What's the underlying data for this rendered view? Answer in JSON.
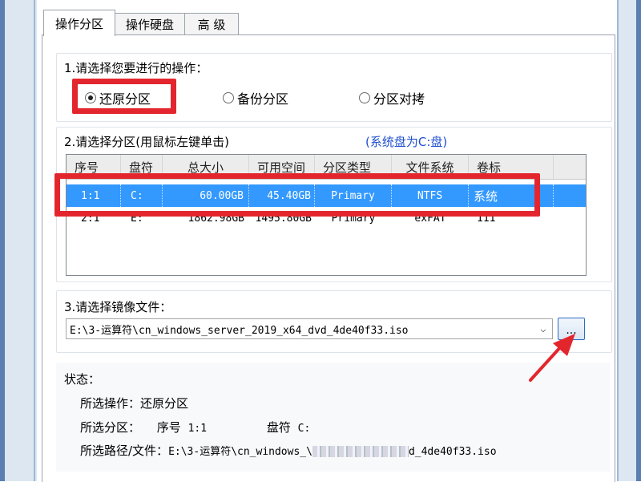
{
  "tabs": [
    {
      "label": "操作分区"
    },
    {
      "label": "操作硬盘"
    },
    {
      "label": "高 级"
    }
  ],
  "section1": {
    "label": "1.请选择您要进行的操作：",
    "options": [
      {
        "label": "还原分区",
        "selected": true
      },
      {
        "label": "备份分区",
        "selected": false
      },
      {
        "label": "分区对拷",
        "selected": false
      }
    ]
  },
  "section2": {
    "label": "2.请选择分区(用鼠标左键单击)",
    "hint": "(系统盘为C:盘)",
    "columns": [
      "序号",
      "盘符",
      "总大小",
      "可用空间",
      "分区类型",
      "文件系统",
      "卷标"
    ],
    "rows": [
      {
        "index": "1:1",
        "drive": "C:",
        "total": "60.00GB",
        "free": "45.40GB",
        "type": "Primary",
        "fs": "NTFS",
        "label": "系统",
        "selected": true
      },
      {
        "index": "2:1",
        "drive": "E:",
        "total": "1862.98GB",
        "free": "1495.80GB",
        "type": "Primary",
        "fs": "exFAT",
        "label": "111",
        "selected": false
      }
    ]
  },
  "section3": {
    "label": "3.请选择镜像文件：",
    "file_path": "E:\\3-运算符\\cn_windows_server_2019_x64_dvd_4de40f33.iso",
    "browse_label": "..."
  },
  "status": {
    "title": "状态：",
    "operation_label": "所选操作：",
    "operation_value": "还原分区",
    "partition_label": "所选分区：",
    "partition_index_label": "序号",
    "partition_index": "1:1",
    "partition_drive_label": "盘符",
    "partition_drive": "C:",
    "path_label": "所选路径/文件：",
    "path_value": "E:\\3-运算符\\cn_windows_\\",
    "path_value_end": "d_4de40f33.iso"
  },
  "colors": {
    "annotation_red": "#e3262d",
    "selection_blue": "#3399ff",
    "hint_blue": "#1f4fd0"
  }
}
